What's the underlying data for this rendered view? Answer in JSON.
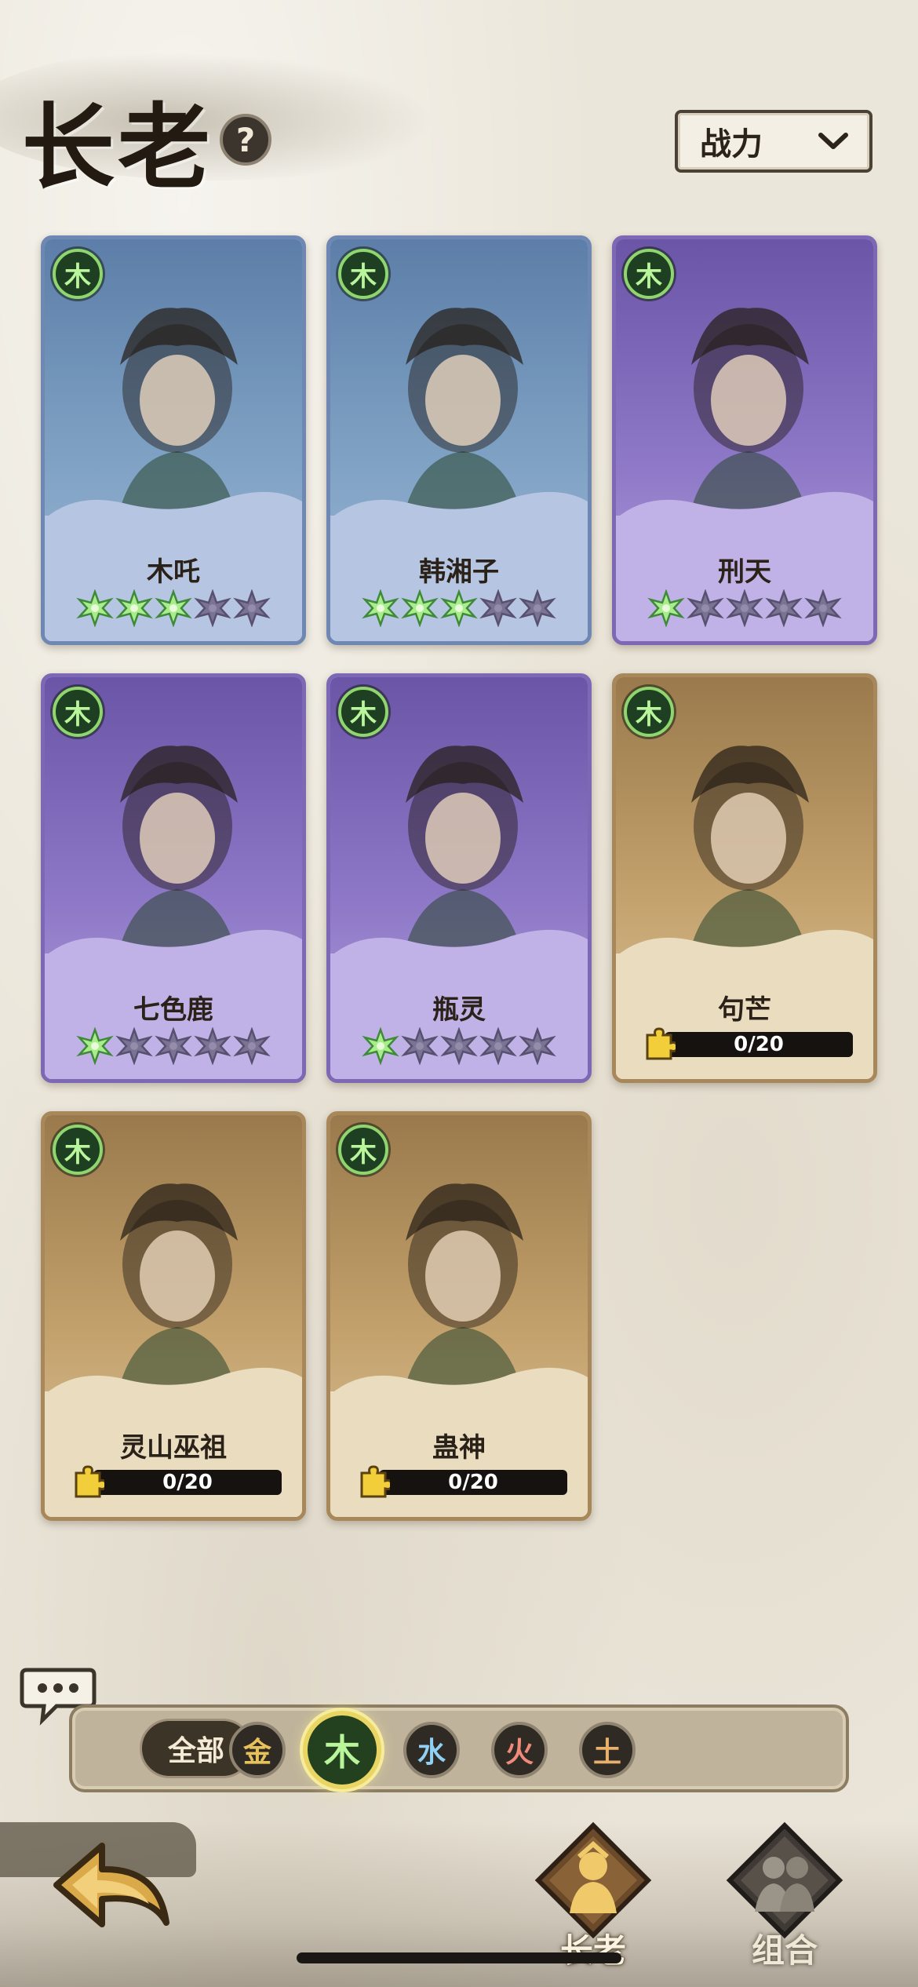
{
  "header": {
    "title": "长老",
    "help_icon": "?",
    "sort": {
      "selected": "战力",
      "icon": "chevron-down-icon"
    }
  },
  "cards": [
    {
      "name": "木吒",
      "element": "木",
      "frame": "blue",
      "stars_filled": 3,
      "stars_total": 5
    },
    {
      "name": "韩湘子",
      "element": "木",
      "frame": "blue",
      "stars_filled": 3,
      "stars_total": 5
    },
    {
      "name": "刑天",
      "element": "木",
      "frame": "purple",
      "stars_filled": 1,
      "stars_total": 5
    },
    {
      "name": "七色鹿",
      "element": "木",
      "frame": "purple",
      "stars_filled": 1,
      "stars_total": 5
    },
    {
      "name": "瓶灵",
      "element": "木",
      "frame": "purple",
      "stars_filled": 1,
      "stars_total": 5
    },
    {
      "name": "句芒",
      "element": "木",
      "frame": "gold",
      "shards": "0/20"
    },
    {
      "name": "灵山巫祖",
      "element": "木",
      "frame": "gold",
      "shards": "0/20"
    },
    {
      "name": "蛊神",
      "element": "木",
      "frame": "gold",
      "shards": "0/20"
    }
  ],
  "filters": {
    "all_label": "全部",
    "elements": [
      {
        "label": "金",
        "color": "#e7c15c",
        "active": false
      },
      {
        "label": "木",
        "color": "#b9f59a",
        "active": true
      },
      {
        "label": "水",
        "color": "#8fd0f4",
        "active": false
      },
      {
        "label": "火",
        "color": "#f08a7a",
        "active": false
      },
      {
        "label": "土",
        "color": "#e8b06a",
        "active": false
      }
    ]
  },
  "nav": {
    "tabs": [
      {
        "label": "长老",
        "icon": "elder-icon",
        "selected": true
      },
      {
        "label": "组合",
        "icon": "combo-icon",
        "selected": false
      }
    ],
    "back_icon": "back-arrow-icon"
  },
  "colors": {
    "background": "#ebe6da",
    "frame_blue": "#6e87b3",
    "frame_purple": "#7d68b6",
    "frame_gold": "#a8885a",
    "wood_green": "#8ed66d"
  }
}
